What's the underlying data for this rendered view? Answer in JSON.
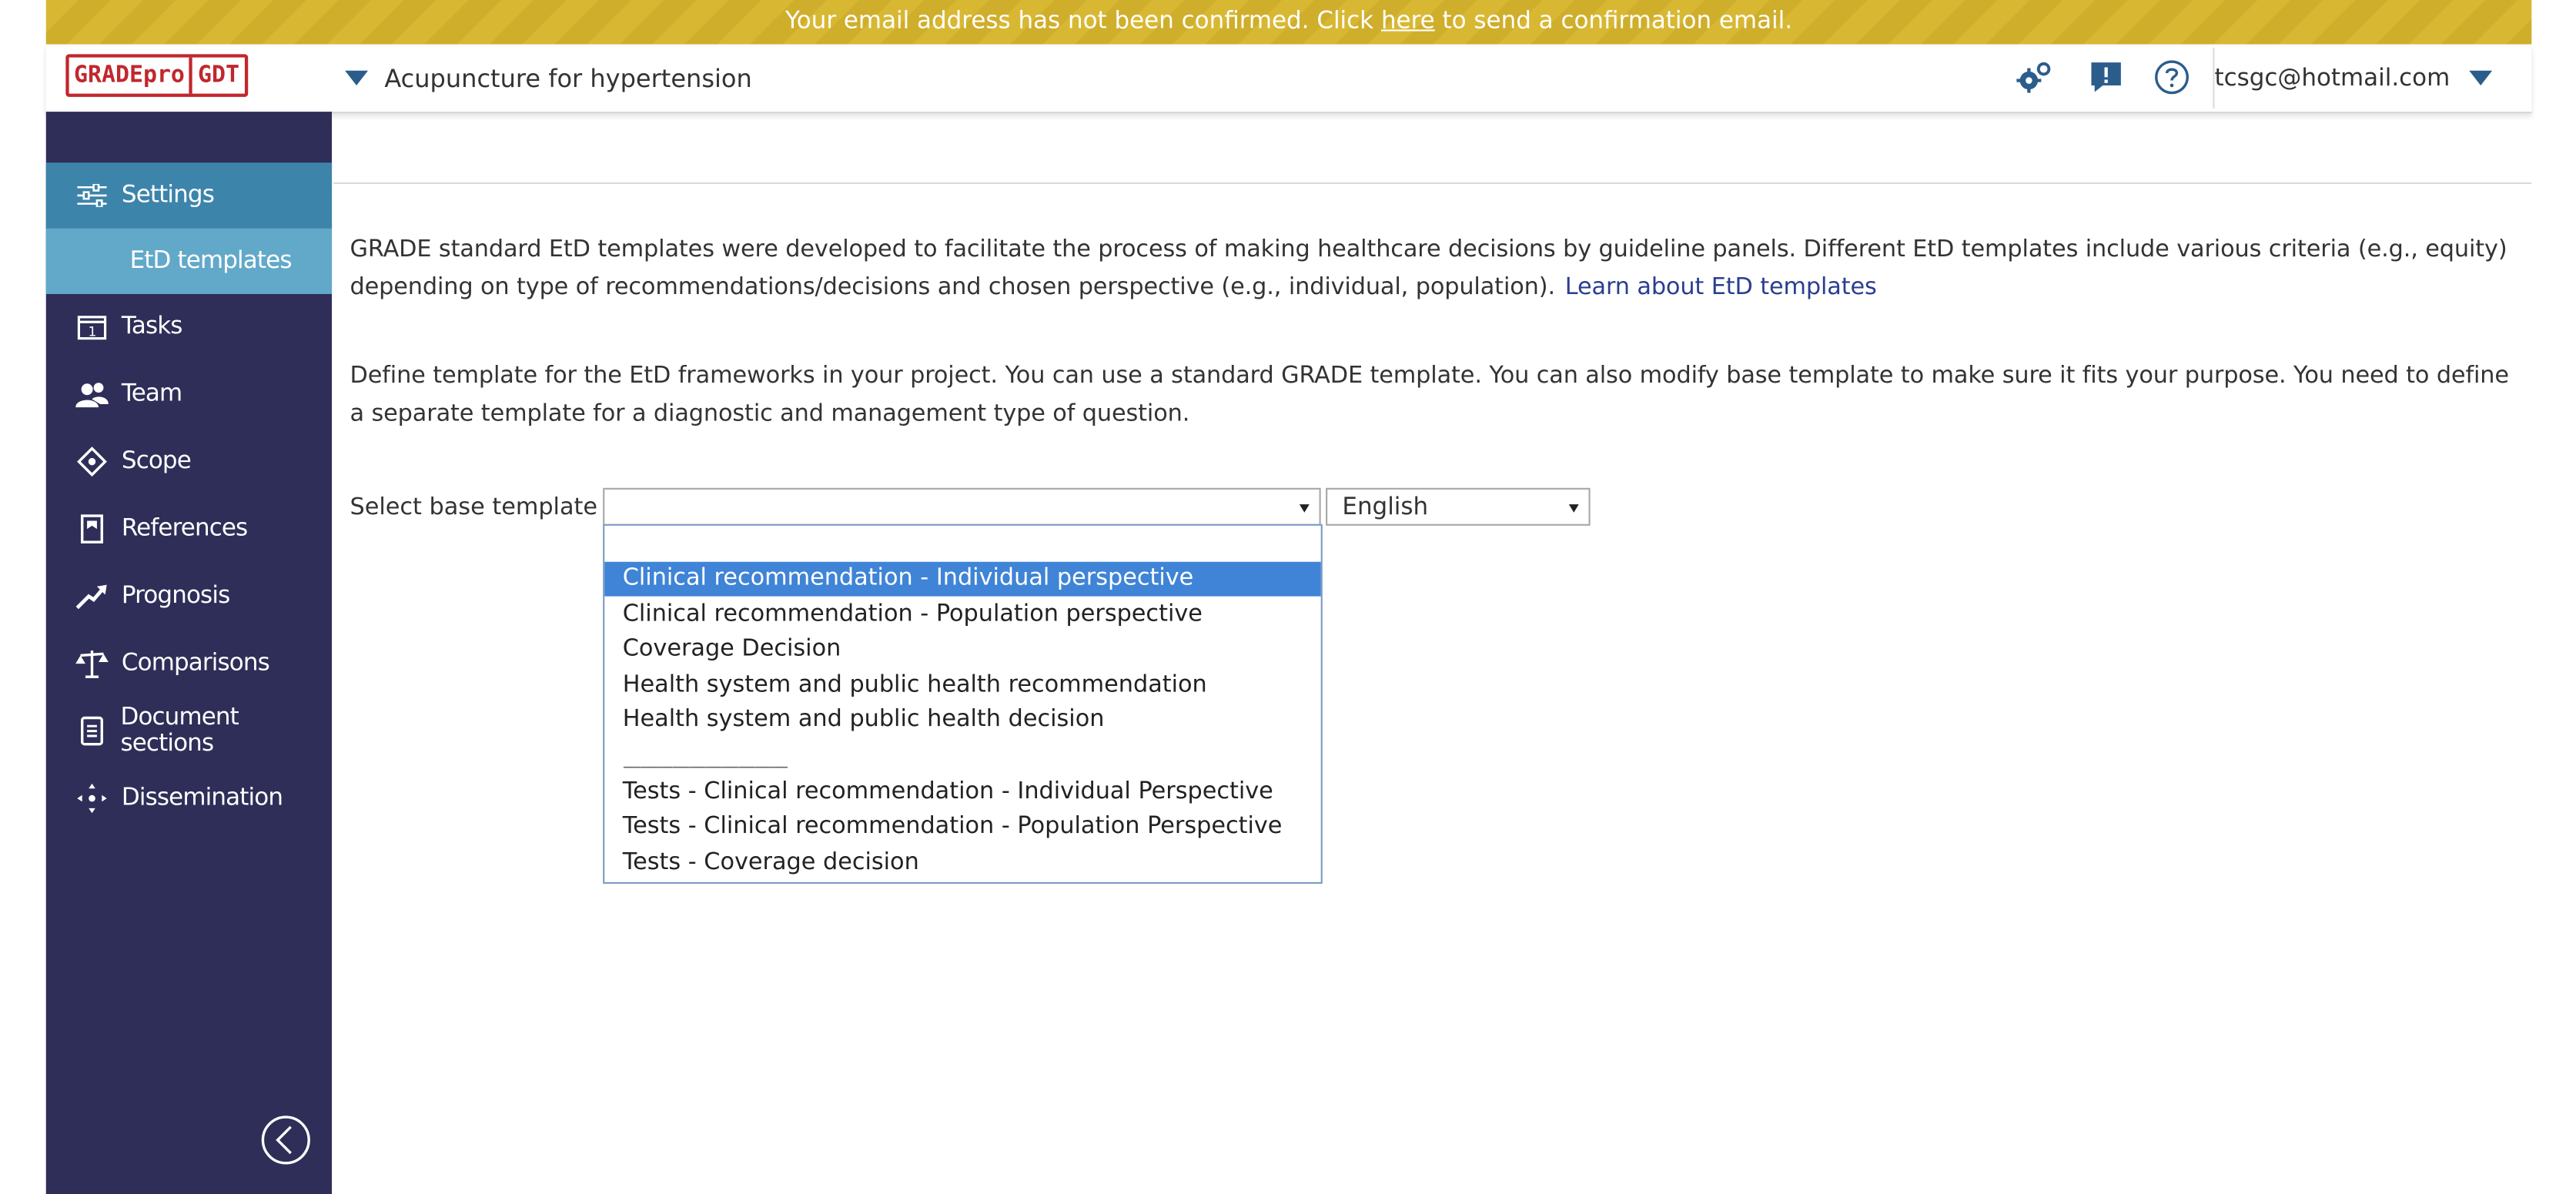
{
  "banner": {
    "text_before": "Your email address has not been confirmed. Click",
    "link_label": "here",
    "text_after": "to send a confirmation email."
  },
  "header": {
    "logo_part1": "GRADEpro",
    "logo_part2": "GDT",
    "project_name": "Acupuncture for hypertension",
    "icons": [
      "settings-gears-icon",
      "feedback-icon",
      "help-icon"
    ],
    "user_email": "tcsgc@hotmail.com"
  },
  "sidebar": {
    "items": [
      {
        "label": "Settings",
        "icon": "sliders-icon"
      },
      {
        "label": "EtD templates",
        "icon": null
      },
      {
        "label": "Tasks",
        "icon": "calendar-icon"
      },
      {
        "label": "Team",
        "icon": "team-icon"
      },
      {
        "label": "Scope",
        "icon": "crosshair-icon"
      },
      {
        "label": "References",
        "icon": "document-icon"
      },
      {
        "label": "Prognosis",
        "icon": "trend-icon"
      },
      {
        "label": "Comparisons",
        "icon": "scales-icon"
      },
      {
        "label": "Document sections",
        "icon": "list-document-icon"
      },
      {
        "label": "Dissemination",
        "icon": "share-icon"
      }
    ],
    "collapse_icon": "chevron-left-circle-icon"
  },
  "main": {
    "para1": "GRADE standard EtD templates were developed to facilitate the process of making healthcare decisions by guideline panels. Different EtD templates include various criteria (e.g., equity) depending on type of recommendations/decisions and chosen perspective (e.g., individual, population).",
    "learn_link": "Learn about EtD templates",
    "para2": "Define template for the EtD frameworks in your project. You can use a standard GRADE template. You can also modify base template to make sure it fits your purpose. You need to define a separate template for a diagnostic and management type of question.",
    "select_label": "Select base template",
    "base_template_value": "",
    "language_value": "English",
    "dropdown_options": [
      "Clinical recommendation - Individual perspective",
      "Clinical recommendation - Population perspective",
      "Coverage Decision",
      "Health system and public health recommendation",
      "Health system and public health decision",
      "Tests - Clinical recommendation - Individual Perspective",
      "Tests - Clinical recommendation - Population Perspective",
      "Tests - Coverage decision"
    ],
    "dropdown_separator": "——————————",
    "highlighted_option": "Clinical recommendation - Individual perspective"
  },
  "colors": {
    "banner": "#d8b833",
    "sidebar": "#2e2e58",
    "sidebar_active": "#3d84ab",
    "sidebar_sub_active": "#62a9c9",
    "link": "#2a3e8e",
    "logo": "#c0272d",
    "accent": "#2b5d8c",
    "option_selected": "#3f84d6"
  }
}
